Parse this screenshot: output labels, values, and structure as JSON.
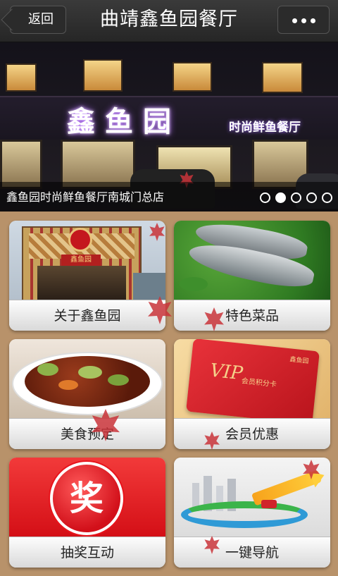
{
  "header": {
    "back_label": "返回",
    "title": "曲靖鑫鱼园餐厅",
    "more_icon": "more-dots-icon"
  },
  "banner": {
    "sign_main": "鑫鱼园",
    "sign_sub": "时尚鲜鱼餐厅",
    "caption": "鑫鱼园时尚鲜鱼餐厅南城门总店",
    "slide_count": 5,
    "active_slide": 2
  },
  "tiles": [
    {
      "label": "关于鑫鱼园",
      "image": "restaurant-storefront",
      "sign_text": "鑫鱼园"
    },
    {
      "label": "特色菜品",
      "image": "fresh-fish-on-greens"
    },
    {
      "label": "美食预定",
      "image": "stir-fry-dish"
    },
    {
      "label": "会员优惠",
      "image": "vip-card",
      "card_text": "VIP",
      "card_sub": "会员积分卡",
      "card_brand": "鑫鱼园"
    },
    {
      "label": "抽奖互动",
      "image": "lottery-prize-icon",
      "icon_char": "奖"
    },
    {
      "label": "一键导航",
      "image": "navigation-route-map"
    }
  ],
  "colors": {
    "background": "#b8926a",
    "topbar": "#2b2b2b",
    "lottery_red": "#e8141c",
    "vip_red": "#d8242a",
    "leaf_red": "#c9343a"
  }
}
